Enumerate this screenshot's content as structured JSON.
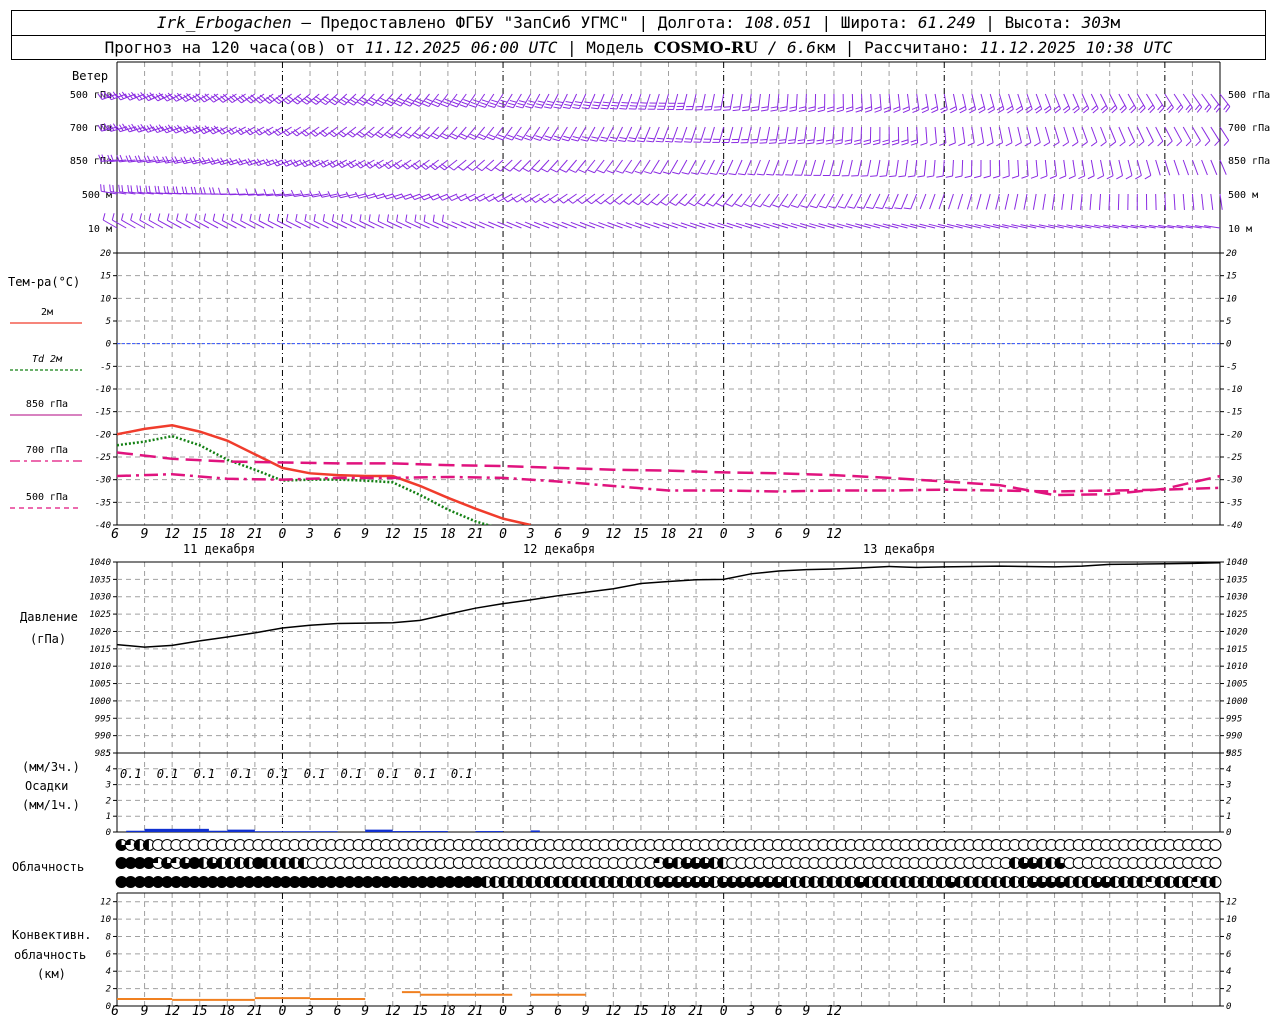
{
  "header": {
    "station": "Irk_Erbogachen",
    "provider": "— Предоставлено ФГБУ \"ЗапСиб УГМС\"",
    "lon_label": "Долгота:",
    "lon": "108.051",
    "lat_label": "Широта:",
    "lat": "61.249",
    "alt_label": "Высота:",
    "alt": "303",
    "alt_unit": "м",
    "forecast_prefix": "Прогноз на 120 часа(ов) от",
    "forecast_time": "11.12.2025 06:00 UTC",
    "model_label": "Модель",
    "model": "COSMO-RU",
    "resolution": "/ 6.6",
    "resolution_unit": "км",
    "calc_label": "Рассчитано:",
    "calc_time": "11.12.2025 10:38 UTC"
  },
  "panels": {
    "wind": {
      "title": "Ветер",
      "levels": [
        "500 гПа",
        "700 гПа",
        "850 гПа",
        "500 м",
        "10 м"
      ]
    },
    "temperature": {
      "title": "Тем-ра(°C)",
      "legend": [
        {
          "label": "2м",
          "style": "solid",
          "color": "#f03c2c"
        },
        {
          "label": "Td  2м",
          "style": "dotted",
          "color": "#138013"
        },
        {
          "label": "850 гПа",
          "style": "solid",
          "color": "#c0389a"
        },
        {
          "label": "700 гПа",
          "style": "dashdot",
          "color": "#e0137e"
        },
        {
          "label": "500 гПа",
          "style": "dashed",
          "color": "#e0137e"
        }
      ]
    },
    "pressure": {
      "title": "Давление",
      "unit": "(гПа)"
    },
    "precip": {
      "unit3": "(мм/3ч.)",
      "title": "Осадки",
      "unit1": "(мм/1ч.)"
    },
    "clouds": {
      "title": "Облачность"
    },
    "convective": {
      "title1": "Конвективн.",
      "title2": "облачность",
      "unit": "(км)"
    }
  },
  "time_axis": {
    "hour_labels": [
      "6",
      "9",
      "12",
      "15",
      "18",
      "21",
      "0",
      "3",
      "6",
      "9",
      "12",
      "15",
      "18",
      "21",
      "0",
      "3",
      "6",
      "9",
      "12",
      "15",
      "18",
      "21",
      "0",
      "3",
      "6",
      "9",
      "12"
    ],
    "day_labels": [
      "11 декабря",
      "12 декабря",
      "13 декабря"
    ]
  },
  "colors": {
    "t2m": "#f03c2c",
    "td2m": "#138013",
    "t700": "#e0137e",
    "t500": "#e0137e",
    "pressure": "#000000",
    "precip": "#1030d0",
    "convective": "#f08020",
    "wind": "#8a2be2",
    "grid": "#a0a0a0",
    "zero_line": "#3050ff"
  },
  "chart_data": [
    {
      "type": "wind_barbs",
      "levels": [
        "500 гПа",
        "700 гПа",
        "850 гПа",
        "500 м",
        "10 м"
      ],
      "x_hours": [
        0,
        120
      ]
    },
    {
      "type": "line",
      "title": "Тем-ра(°C)",
      "ylim": [
        -40,
        20
      ],
      "yticks": [
        20,
        15,
        10,
        5,
        0,
        -5,
        -10,
        -15,
        -20,
        -25,
        -30,
        -35,
        -40
      ],
      "series": [
        {
          "name": "2м",
          "x": [
            0,
            3,
            6,
            9,
            12,
            15,
            18,
            21,
            24,
            27,
            30,
            33,
            36,
            39,
            42,
            45
          ],
          "values": [
            -20,
            -18.8,
            -18,
            -19.4,
            -21.4,
            -24.4,
            -27.4,
            -28.6,
            -29,
            -29.2,
            -29.2,
            -31.4,
            -34,
            -36.4,
            -38.6,
            -40
          ]
        },
        {
          "name": "Td  2м",
          "x": [
            0,
            3,
            6,
            9,
            12,
            15,
            18,
            21,
            24,
            27,
            30,
            33,
            36,
            39,
            42
          ],
          "values": [
            -22.4,
            -21.6,
            -20.4,
            -22.4,
            -25.6,
            -27.8,
            -30.2,
            -30,
            -30,
            -30.2,
            -30.6,
            -33.4,
            -36.6,
            -39.2,
            -41
          ]
        },
        {
          "name": "700 гПа",
          "x": [
            0,
            6,
            12,
            18,
            24,
            30,
            36,
            42,
            48,
            54,
            60,
            66,
            72,
            78,
            84,
            90,
            96,
            102,
            108,
            114,
            120
          ],
          "values": [
            -29.2,
            -28.8,
            -29.8,
            -30,
            -29.6,
            -29.6,
            -29.4,
            -29.6,
            -30.4,
            -31.4,
            -32.4,
            -32.4,
            -32.6,
            -32.4,
            -32.4,
            -32.2,
            -32.4,
            -32.6,
            -32.4,
            -32.2,
            -31.8
          ]
        },
        {
          "name": "500 гПа",
          "x": [
            0,
            6,
            12,
            18,
            24,
            30,
            36,
            42,
            48,
            54,
            60,
            66,
            72,
            78,
            84,
            90,
            96,
            102,
            108,
            114,
            120
          ],
          "values": [
            -24,
            -25.4,
            -26,
            -26.2,
            -26.4,
            -26.4,
            -26.8,
            -27,
            -27.4,
            -27.8,
            -28,
            -28.4,
            -28.6,
            -29,
            -29.6,
            -30.4,
            -31.2,
            -33.4,
            -33.2,
            -32,
            -29.2
          ]
        }
      ],
      "x_range": [
        0,
        120
      ]
    },
    {
      "type": "line",
      "title": "Давление",
      "ylabel": "(гПа)",
      "ylim": [
        985,
        1040
      ],
      "yticks": [
        1040,
        1035,
        1030,
        1025,
        1020,
        1015,
        1010,
        1005,
        1000,
        995,
        990,
        985
      ],
      "series": [
        {
          "name": "Давление",
          "x": [
            0,
            3,
            6,
            9,
            12,
            15,
            18,
            21,
            24,
            27,
            30,
            33,
            36,
            39,
            42,
            45,
            48,
            51,
            54,
            57,
            60,
            63,
            66,
            69,
            72,
            75,
            78,
            81,
            84,
            87,
            90,
            93,
            96,
            99,
            102,
            105,
            108,
            111,
            114,
            117,
            120
          ],
          "values": [
            1016.2,
            1015.5,
            1016,
            1017.3,
            1018.4,
            1019.6,
            1021,
            1021.8,
            1022.3,
            1022.4,
            1022.5,
            1023.2,
            1025,
            1026.7,
            1028,
            1029.1,
            1030.3,
            1031.3,
            1032.3,
            1033.8,
            1034.4,
            1034.9,
            1035,
            1036.6,
            1037.4,
            1037.8,
            1038,
            1038.3,
            1038.7,
            1038.4,
            1038.6,
            1038.7,
            1038.8,
            1038.7,
            1038.6,
            1038.8,
            1039.3,
            1039.4,
            1039.5,
            1039.6,
            1039.8
          ]
        }
      ],
      "x_range": [
        0,
        120
      ]
    },
    {
      "type": "bar",
      "title": "Осадки",
      "ylim": [
        0,
        5
      ],
      "annotations_3h": [
        "0.1",
        "0.1",
        "0.1",
        "0.1",
        "0.1",
        "0.1",
        "0.1",
        "0.1",
        "0.1",
        "0.1"
      ],
      "bars_1h": [
        {
          "from": 1,
          "to": 3,
          "value": 0.08
        },
        {
          "from": 3,
          "to": 10,
          "value": 0.2
        },
        {
          "from": 10,
          "to": 12,
          "value": 0.08
        },
        {
          "from": 12,
          "to": 15,
          "value": 0.15
        },
        {
          "from": 15,
          "to": 24,
          "value": 0.05
        },
        {
          "from": 27,
          "to": 30,
          "value": 0.15
        },
        {
          "from": 30,
          "to": 36,
          "value": 0.06
        },
        {
          "from": 39,
          "to": 42,
          "value": 0.06
        },
        {
          "from": 45,
          "to": 46,
          "value": 0.1
        }
      ]
    },
    {
      "type": "symbols",
      "title": "Облачность",
      "rows": [
        "3122000000000000000000000000000000000000000000000000000000000000000000000000000000000000000000000000000000000000000000000",
        "4444131342322224222220000000000000000000000000000000000000013233322000000000000000000000000000000023322300000000000000000",
        "4444444444444444444444444444444444444444222222222222222222233333323333333222222223222222222322222222333322233222212222122"
      ]
    },
    {
      "type": "step",
      "title": "Конвективн. облачность",
      "ylabel": "(км)",
      "ylim": [
        0,
        13
      ],
      "yticks": [
        12,
        10,
        8,
        6,
        4,
        2,
        0
      ],
      "segments": [
        {
          "from": 0,
          "to": 6,
          "value": 0.8
        },
        {
          "from": 6,
          "to": 15,
          "value": 0.7
        },
        {
          "from": 15,
          "to": 21,
          "value": 0.9
        },
        {
          "from": 21,
          "to": 27,
          "value": 0.8
        },
        {
          "from": 31,
          "to": 33,
          "value": 1.6
        },
        {
          "from": 33,
          "to": 43,
          "value": 1.3
        },
        {
          "from": 45,
          "to": 51,
          "value": 1.3
        }
      ]
    }
  ]
}
